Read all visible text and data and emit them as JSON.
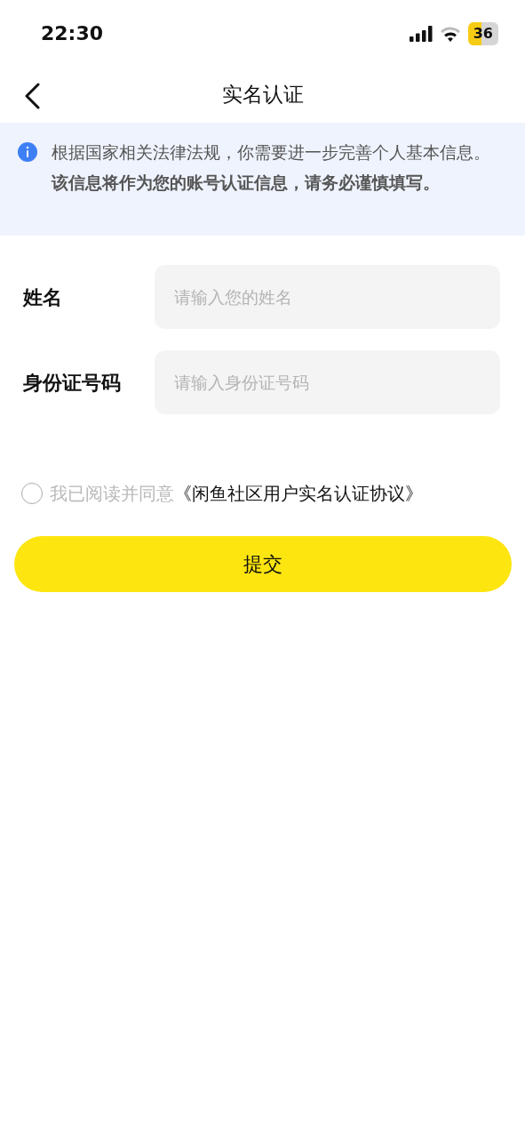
{
  "status_bar": {
    "time": "22:30",
    "battery": "36"
  },
  "nav_bar": {
    "title": "实名认证"
  },
  "notice": {
    "text": "根据国家相关法律法规，你需要进一步完善个人基本信息。**该信息将作为您的账号认证信息，请务必谨慎填写。**"
  },
  "fields": [
    {
      "label": "姓名",
      "placeholder": "请输入您的姓名"
    },
    {
      "label": "身份证号码",
      "placeholder": "请输入身份证号码"
    }
  ],
  "agreement": {
    "checked": false,
    "text": "我已阅读并同意",
    "link": "《闲鱼社区用户实名认证协议》"
  },
  "submit_button": "提交"
}
